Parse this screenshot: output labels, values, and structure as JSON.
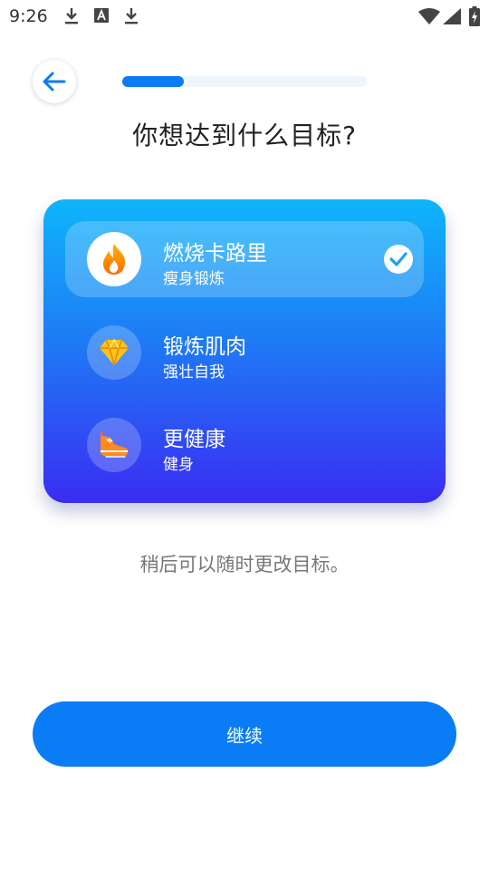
{
  "status_bar": {
    "time": "9:26",
    "icons": [
      "download-icon",
      "font-icon",
      "download-icon",
      "wifi-icon",
      "signal-icon",
      "battery-charging-icon"
    ]
  },
  "header": {
    "back_icon": "arrow-left-icon",
    "progress_fraction": 0.25
  },
  "title": "你想达到什么目标?",
  "options": [
    {
      "title": "燃烧卡路里",
      "subtitle": "瘦身锻炼",
      "icon": "fire-icon",
      "selected": true
    },
    {
      "title": "锻炼肌肉",
      "subtitle": "强壮自我",
      "icon": "diamond-icon",
      "selected": false
    },
    {
      "title": "更健康",
      "subtitle": "健身",
      "icon": "sneaker-icon",
      "selected": false
    }
  ],
  "hint": "稍后可以随时更改目标。",
  "continue_label": "继续",
  "colors": {
    "accent": "#0a7cf5",
    "card_top": "#0fb5fb",
    "card_bottom": "#3a2cf3"
  }
}
